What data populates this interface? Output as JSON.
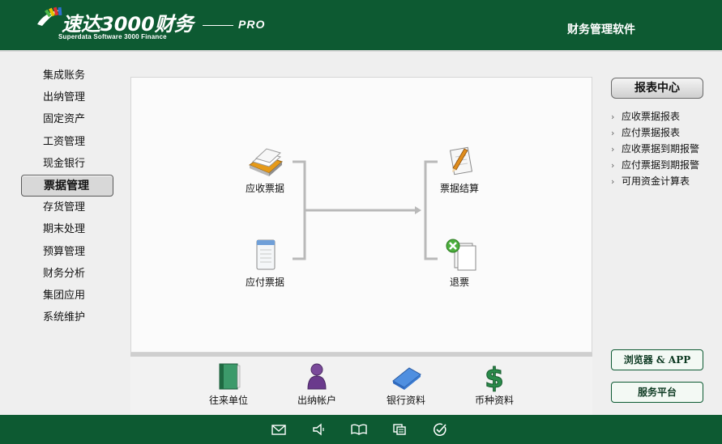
{
  "header": {
    "title": "速达3000财务",
    "subtitle": "Superdata Software 3000 Finance",
    "edition": "PRO",
    "right_text": "财务管理软件"
  },
  "leftnav": {
    "items": [
      {
        "label": "集成账务"
      },
      {
        "label": "出纳管理"
      },
      {
        "label": "固定资产"
      },
      {
        "label": "工资管理"
      },
      {
        "label": "现金银行"
      },
      {
        "label": "票据管理",
        "active": true
      },
      {
        "label": "存货管理"
      },
      {
        "label": "期末处理"
      },
      {
        "label": "预算管理"
      },
      {
        "label": "财务分析"
      },
      {
        "label": "集团应用"
      },
      {
        "label": "系统维护"
      }
    ]
  },
  "flow": {
    "receivable": "应收票据",
    "payable": "应付票据",
    "settle": "票据结算",
    "refund": "退票"
  },
  "bottom_tools": {
    "partners": "往来单位",
    "cashier_accounts": "出纳帐户",
    "bank_info": "银行资料",
    "currency_info": "币种资料"
  },
  "report_center": {
    "title": "报表中心",
    "items": [
      {
        "label": "应收票据报表"
      },
      {
        "label": "应付票据报表"
      },
      {
        "label": "应收票据到期报警"
      },
      {
        "label": "应付票据到期报警"
      },
      {
        "label": "可用资金计算表"
      }
    ]
  },
  "right_buttons": {
    "browser_app": "浏览器 & APP",
    "service": "服务平台"
  },
  "colors": {
    "brand_green": "#0d5a32",
    "flow_line": "#b9b9b9"
  },
  "footer_icons": [
    "mail-icon",
    "speaker-icon",
    "book-icon",
    "window-icon",
    "check-icon"
  ]
}
